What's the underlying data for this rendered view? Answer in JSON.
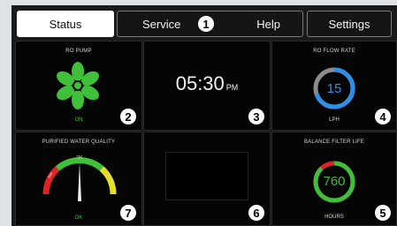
{
  "tabs": {
    "status": "Status",
    "service": "Service",
    "help": "Help",
    "settings": "Settings"
  },
  "markers": [
    "1",
    "2",
    "3",
    "4",
    "5",
    "6",
    "7"
  ],
  "ro_pump": {
    "title": "RO PUMP",
    "status": "ON"
  },
  "clock": {
    "time": "05:30",
    "ampm": "PM"
  },
  "ro_flow_rate": {
    "title": "RO FLOW RATE",
    "value": "15",
    "unit": "LPH",
    "level": 0.7
  },
  "water_quality": {
    "title": "PURIFIED WATER QUALITY",
    "gauge_ok": "OK",
    "status": "OK",
    "left_label": "Bad",
    "right_label": "Service"
  },
  "filter_life": {
    "title": "BALANCE FILTER LIFE",
    "value": "760",
    "unit": "HOURS",
    "level": 0.88
  },
  "colors": {
    "accent_green": "#3fbf3a",
    "flow_blue": "#2f8fe6",
    "ring_gray": "#8c8c8c",
    "alert_red": "#e02222",
    "warn_yellow": "#e6e01e"
  }
}
